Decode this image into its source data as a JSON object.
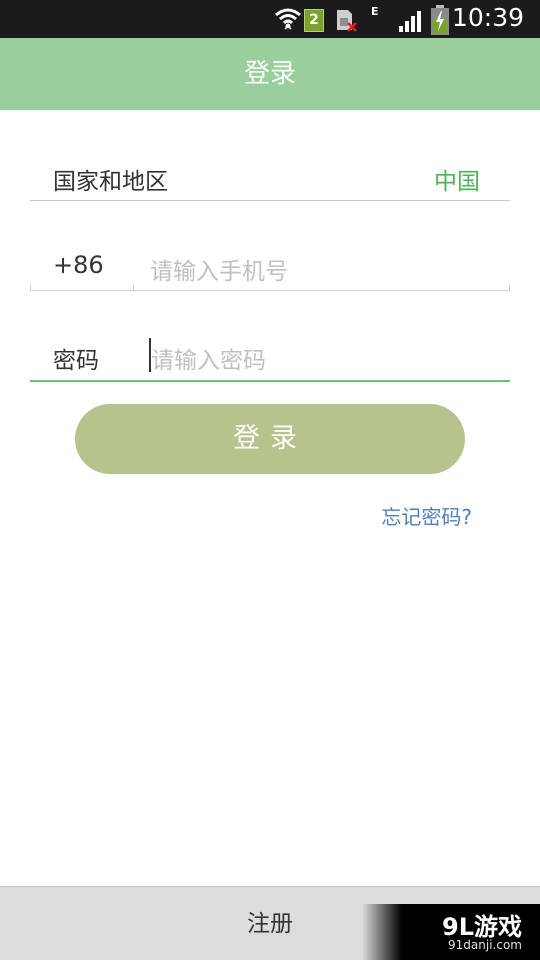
{
  "status_bar": {
    "time": "10:39",
    "sim_badge": "2",
    "network_type": "E",
    "icons": [
      "wifi-icon",
      "sim2-icon",
      "sim-error-icon",
      "signal-icon",
      "battery-charging-icon"
    ]
  },
  "header": {
    "title": "登录"
  },
  "form": {
    "region_label": "国家和地区",
    "region_value": "中国",
    "country_code": "+86",
    "phone_placeholder": "请输入手机号",
    "password_label": "密码",
    "password_placeholder": "请输入密码",
    "login_button": "登录",
    "forgot_link": "忘记密码?"
  },
  "bottom_bar": {
    "register_label": "注册"
  },
  "watermark": {
    "brand": "9L游戏",
    "url": "91danji.com"
  },
  "colors": {
    "header_bg": "#99cf9c",
    "accent_green": "#4cb45a",
    "login_button_bg": "#b4c48c",
    "link_blue": "#4f7fbf",
    "bottom_bar_bg": "#dcdcdc"
  }
}
